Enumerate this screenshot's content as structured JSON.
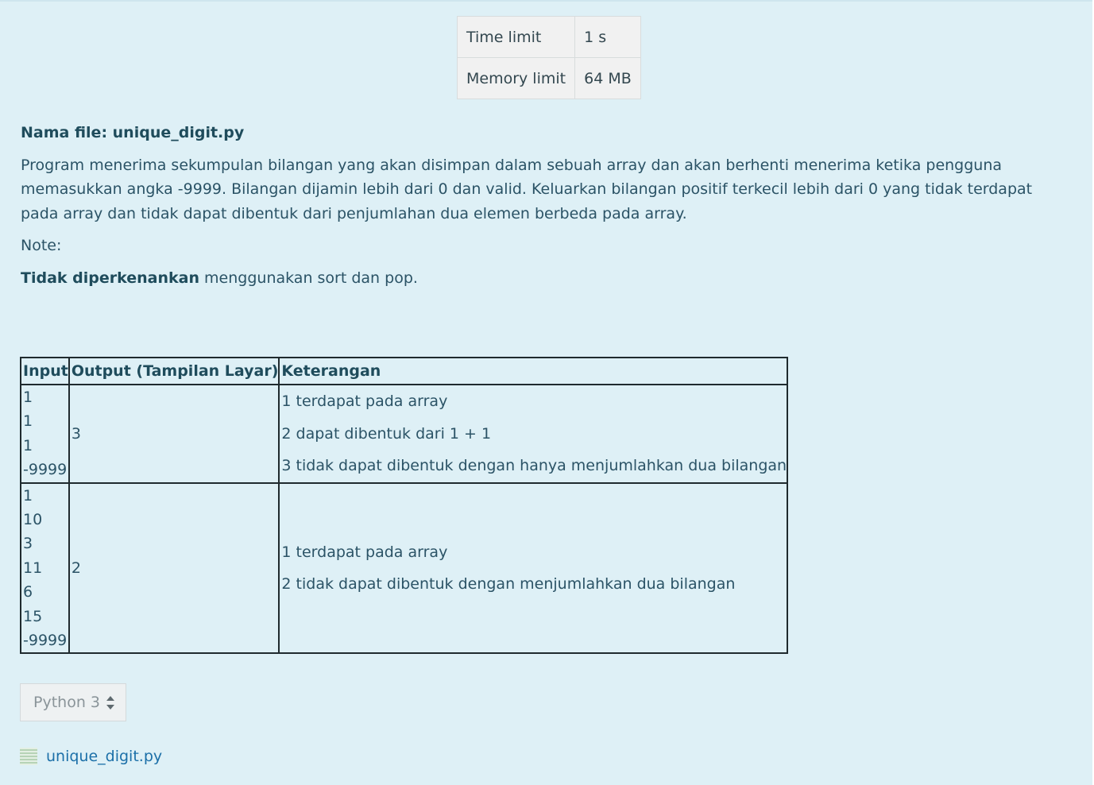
{
  "limits": {
    "time_label": "Time limit",
    "time_value": "1 s",
    "memory_label": "Memory limit",
    "memory_value": "64 MB"
  },
  "problem": {
    "filename_line": "Nama file: unique_digit.py",
    "description": "Program menerima sekumpulan bilangan yang akan disimpan dalam sebuah array dan akan berhenti menerima ketika pengguna memasukkan angka -9999. Bilangan dijamin lebih dari 0 dan valid. Keluarkan bilangan positif terkecil lebih dari 0 yang tidak terdapat pada array dan tidak dapat dibentuk dari penjumlahan dua elemen berbeda pada array.",
    "note_label": "Note:",
    "restriction_bold": "Tidak diperkenankan",
    "restriction_rest": " menggunakan sort dan pop."
  },
  "examples": {
    "headers": [
      "Input",
      "Output (Tampilan Layar)",
      "Keterangan"
    ],
    "rows": [
      {
        "input": [
          "1",
          "1",
          "1",
          "-9999"
        ],
        "output": "3",
        "notes": [
          "1 terdapat pada array",
          "2 dapat dibentuk dari 1 + 1",
          "3 tidak dapat dibentuk dengan hanya menjumlahkan dua bilangan"
        ]
      },
      {
        "input": [
          "1",
          "10",
          "3",
          "11",
          "6",
          "15",
          "-9999"
        ],
        "output": "2",
        "notes": [
          "1 terdapat pada array",
          "2 tidak dapat dibentuk dengan menjumlahkan dua bilangan"
        ]
      }
    ]
  },
  "language_select": {
    "selected": "Python 3",
    "icon": "up-down-arrows-icon"
  },
  "file": {
    "name": "unique_digit.py",
    "icon": "text-file-icon"
  },
  "colors": {
    "panel_background": "#def0f6",
    "text": "#2b5366",
    "link": "#1b6fa8"
  }
}
